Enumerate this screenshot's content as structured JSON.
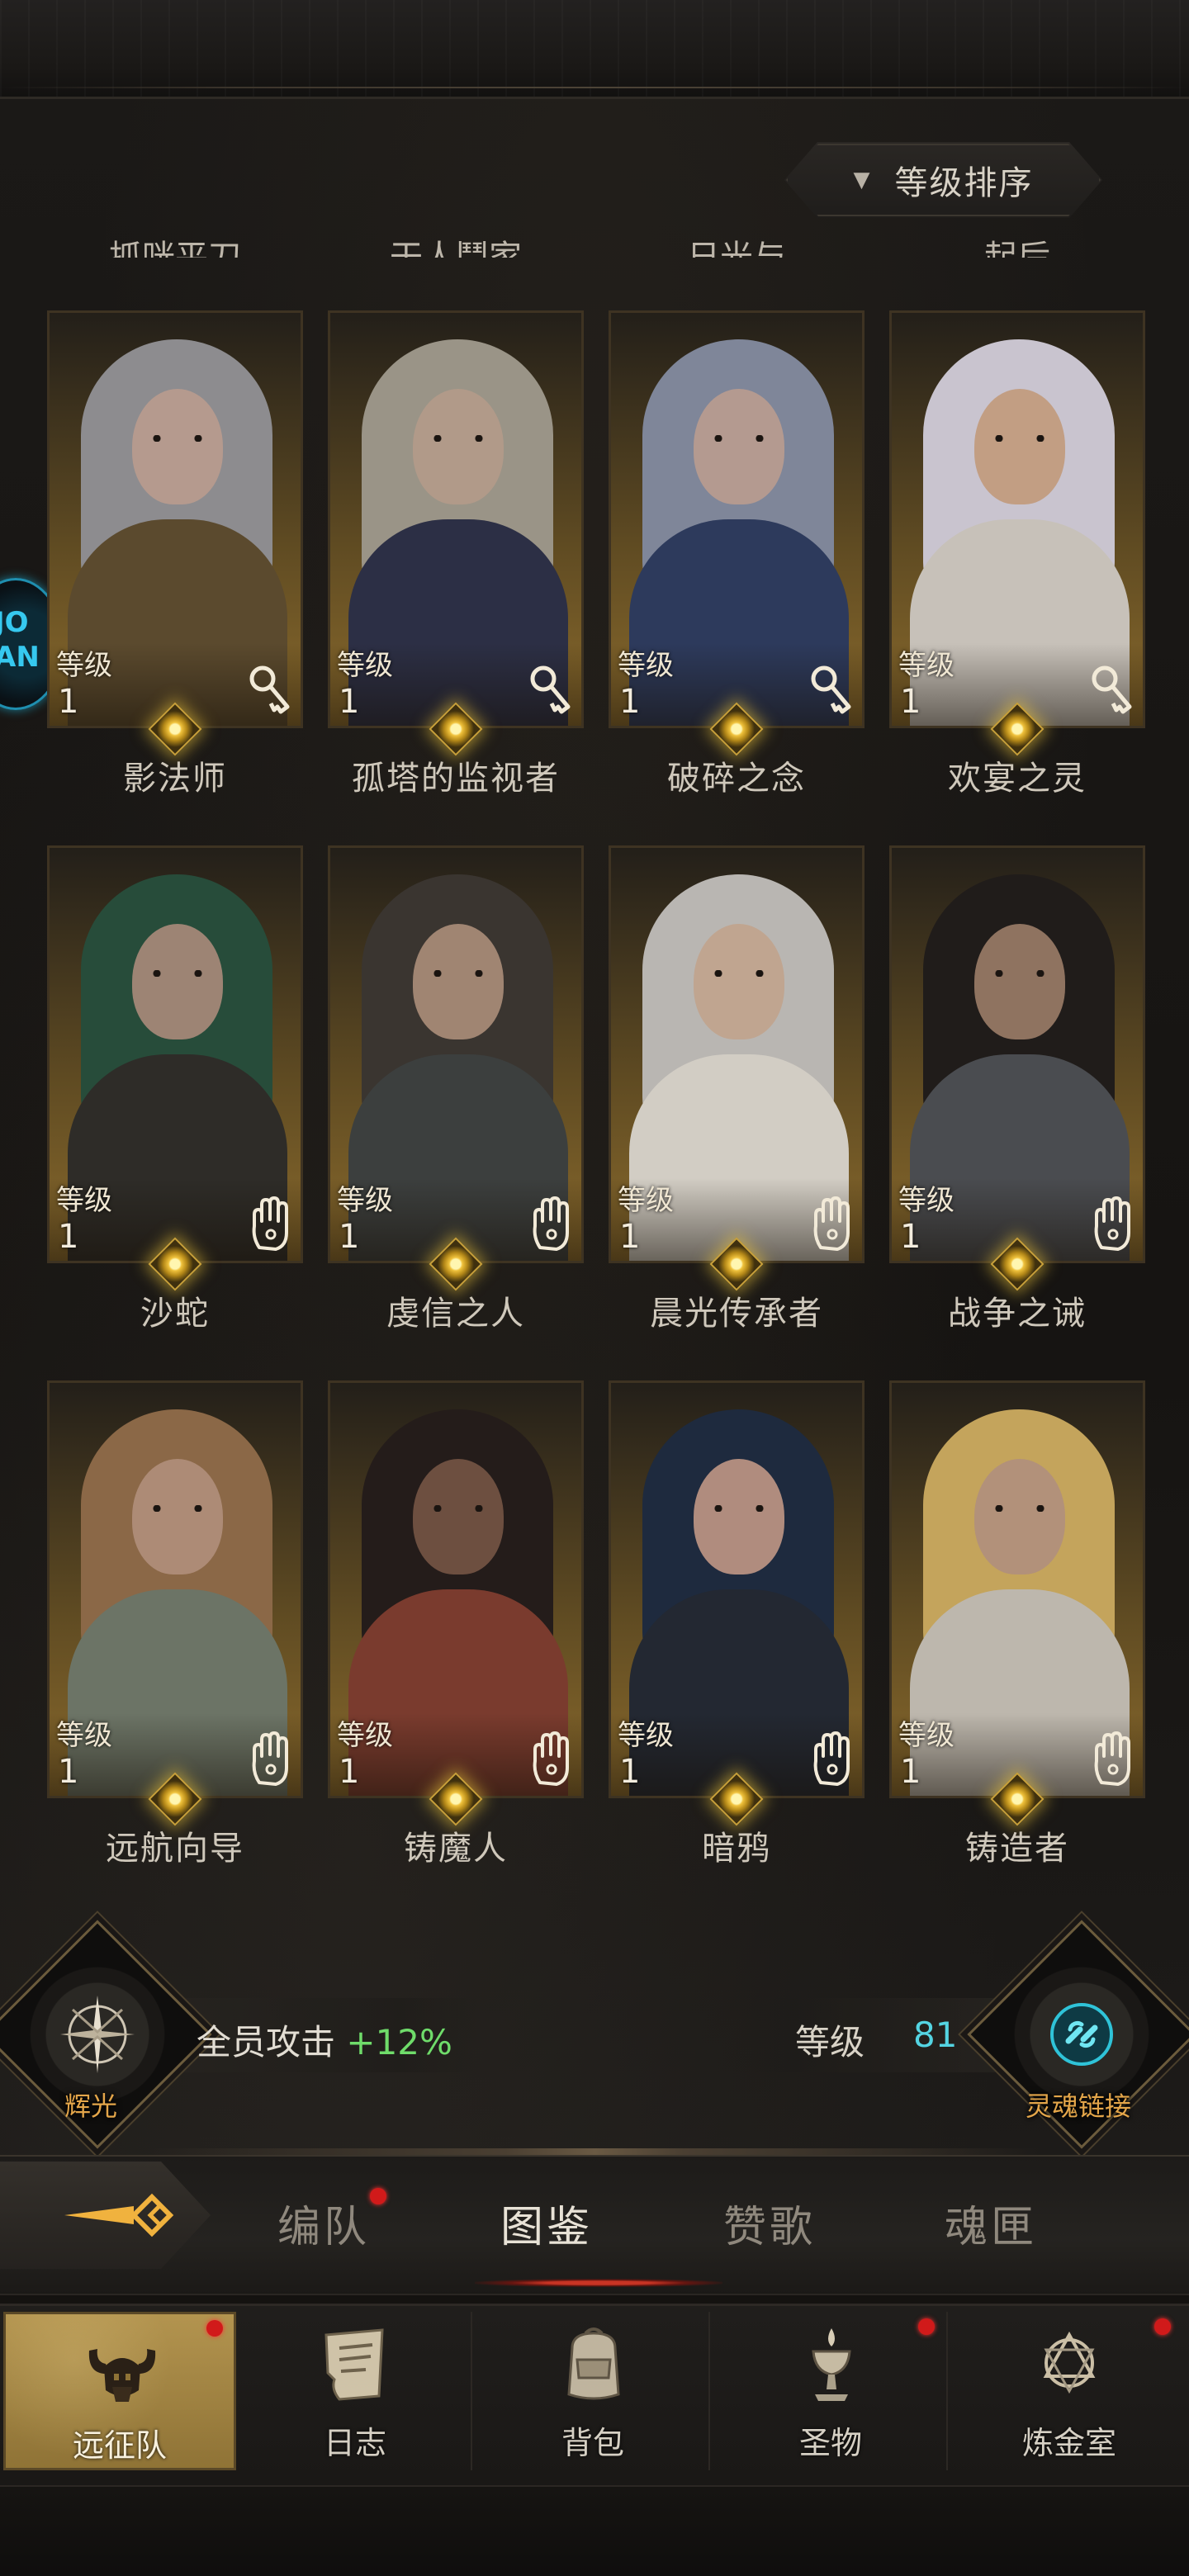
{
  "sort": {
    "label": "等级排序",
    "arrow_icon": "triangle-down-icon"
  },
  "cut_off_names": [
    "抓咣平刀",
    "干人鬥家",
    "日光与",
    "起后"
  ],
  "side_badge": {
    "text": "JO\nAN"
  },
  "heroes": [
    {
      "name": "影法师",
      "level_label": "等级",
      "level": "1",
      "class_icon": "key-icon",
      "palette": {
        "hair": "#8d8c8f",
        "face": "#b59a8e",
        "body": "#5b4a2e"
      }
    },
    {
      "name": "孤塔的监视者",
      "level_label": "等级",
      "level": "1",
      "class_icon": "key-icon",
      "palette": {
        "hair": "#9a9487",
        "face": "#b19a89",
        "body": "#2c2f45"
      }
    },
    {
      "name": "破碎之念",
      "level_label": "等级",
      "level": "1",
      "class_icon": "key-icon",
      "palette": {
        "hair": "#7f8699",
        "face": "#b49a90",
        "body": "#2d3a5c"
      }
    },
    {
      "name": "欢宴之灵",
      "level_label": "等级",
      "level": "1",
      "class_icon": "key-icon",
      "palette": {
        "hair": "#c9c4cf",
        "face": "#c29e83",
        "body": "#c7c1b9"
      }
    },
    {
      "name": "沙蛇",
      "level_label": "等级",
      "level": "1",
      "class_icon": "hand-icon",
      "palette": {
        "hair": "#274c3a",
        "face": "#9d8474",
        "body": "#2e2c28"
      }
    },
    {
      "name": "虔信之人",
      "level_label": "等级",
      "level": "1",
      "class_icon": "hand-icon",
      "palette": {
        "hair": "#3a3530",
        "face": "#a08572",
        "body": "#3c3f3e"
      }
    },
    {
      "name": "晨光传承者",
      "level_label": "等级",
      "level": "1",
      "class_icon": "hand-icon",
      "palette": {
        "hair": "#b9b6b2",
        "face": "#c0a590",
        "body": "#d2cdc4"
      }
    },
    {
      "name": "战争之诫",
      "level_label": "等级",
      "level": "1",
      "class_icon": "hand-icon",
      "palette": {
        "hair": "#201c1a",
        "face": "#8f7360",
        "body": "#4a4c50"
      }
    },
    {
      "name": "远航向导",
      "level_label": "等级",
      "level": "1",
      "class_icon": "hand-icon",
      "palette": {
        "hair": "#8b6847",
        "face": "#ad8b76",
        "body": "#6c7466"
      }
    },
    {
      "name": "铸魔人",
      "level_label": "等级",
      "level": "1",
      "class_icon": "hand-icon",
      "palette": {
        "hair": "#241c1a",
        "face": "#6d4f40",
        "body": "#7a3b2e"
      }
    },
    {
      "name": "暗鸦",
      "level_label": "等级",
      "level": "1",
      "class_icon": "hand-icon",
      "palette": {
        "hair": "#1e2a3e",
        "face": "#b08c7e",
        "body": "#232832"
      }
    },
    {
      "name": "铸造者",
      "level_label": "等级",
      "level": "1",
      "class_icon": "hand-icon",
      "palette": {
        "hair": "#c4a45c",
        "face": "#b2917a",
        "body": "#bdb7ad"
      }
    }
  ],
  "bonus": {
    "left_emblem_label": "辉光",
    "left_emblem_icon": "radiant-sword-icon",
    "attack_label": "全员攻击",
    "attack_value": "+12%",
    "level_label": "等级",
    "level_value": "81",
    "right_emblem_label": "灵魂链接",
    "right_emblem_icon": "soul-link-icon"
  },
  "tabs": [
    {
      "label": "编队",
      "active": false,
      "dot": true
    },
    {
      "label": "图鉴",
      "active": true,
      "dot": false
    },
    {
      "label": "赞歌",
      "active": false,
      "dot": false
    },
    {
      "label": "魂匣",
      "active": false,
      "dot": false
    }
  ],
  "nav": [
    {
      "label": "远征队",
      "icon": "horned-helmet-icon",
      "active": true,
      "dot": true
    },
    {
      "label": "日志",
      "icon": "scroll-icon",
      "active": false,
      "dot": false
    },
    {
      "label": "背包",
      "icon": "backpack-icon",
      "active": false,
      "dot": false
    },
    {
      "label": "圣物",
      "icon": "chalice-icon",
      "active": false,
      "dot": true
    },
    {
      "label": "炼金室",
      "icon": "alchemy-icon",
      "active": false,
      "dot": true
    }
  ],
  "colors": {
    "accent_gold": "#c9a13a",
    "bonus_green": "#6fdc6a",
    "level_cyan": "#54d4e2",
    "label_orange": "#e4a64a",
    "dot_red": "#d11a1a"
  }
}
